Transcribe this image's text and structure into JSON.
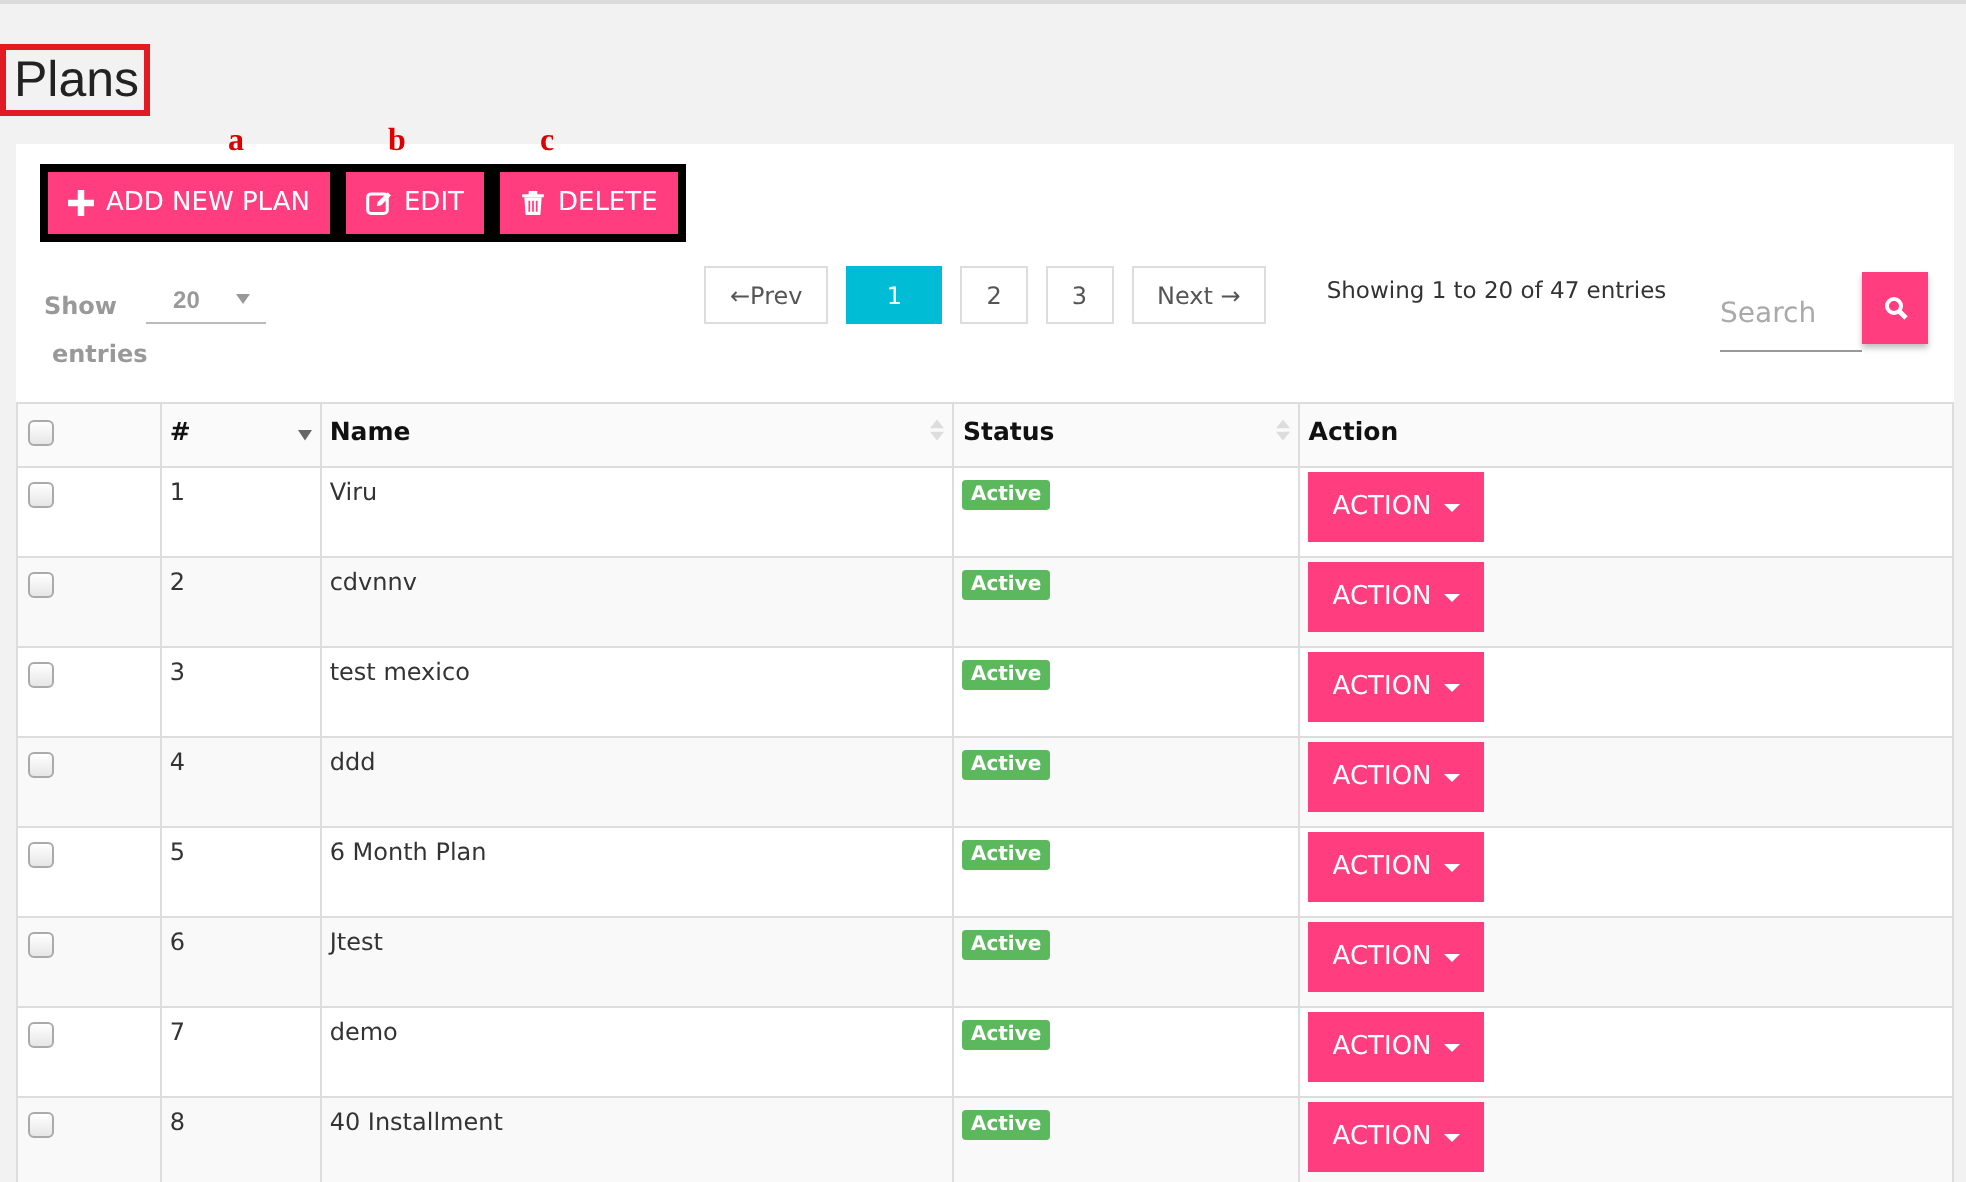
{
  "page_title": "Plans",
  "annotations": [
    "a",
    "b",
    "c"
  ],
  "toolbar": [
    {
      "kind": "add",
      "label": "ADD NEW PLAN"
    },
    {
      "kind": "edit",
      "label": "EDIT"
    },
    {
      "kind": "delete",
      "label": "DELETE"
    }
  ],
  "length_menu": {
    "prefix": "Show",
    "value": "20",
    "suffix": "entries"
  },
  "pagination": [
    {
      "label": "←Prev",
      "selected": false
    },
    {
      "label": "1",
      "selected": true
    },
    {
      "label": "2",
      "selected": false
    },
    {
      "label": "3",
      "selected": false
    },
    {
      "label": "Next →",
      "selected": false
    }
  ],
  "info": "Showing 1 to 20 of 47 entries",
  "search": {
    "placeholder": "Search"
  },
  "table": {
    "select_all_checked": false,
    "columns": [
      {
        "kind": "check"
      },
      {
        "label": "#",
        "kind": "sorted"
      },
      {
        "label": "Name",
        "kind": "sortable"
      },
      {
        "label": "Status",
        "kind": "sortable"
      },
      {
        "label": "Action",
        "kind": "plain"
      }
    ],
    "rows": [
      {
        "checked": false,
        "num": "1",
        "name": "Viru",
        "status": "Active",
        "action": "ACTION"
      },
      {
        "checked": false,
        "num": "2",
        "name": "cdvnnv",
        "status": "Active",
        "action": "ACTION"
      },
      {
        "checked": false,
        "num": "3",
        "name": "test mexico",
        "status": "Active",
        "action": "ACTION"
      },
      {
        "checked": false,
        "num": "4",
        "name": "ddd",
        "status": "Active",
        "action": "ACTION"
      },
      {
        "checked": false,
        "num": "5",
        "name": "6 Month Plan",
        "status": "Active",
        "action": "ACTION"
      },
      {
        "checked": false,
        "num": "6",
        "name": "Jtest",
        "status": "Active",
        "action": "ACTION"
      },
      {
        "checked": false,
        "num": "7",
        "name": "demo",
        "status": "Active",
        "action": "ACTION"
      },
      {
        "checked": false,
        "num": "8",
        "name": "40 Installment",
        "status": "Active",
        "action": "ACTION"
      }
    ]
  }
}
